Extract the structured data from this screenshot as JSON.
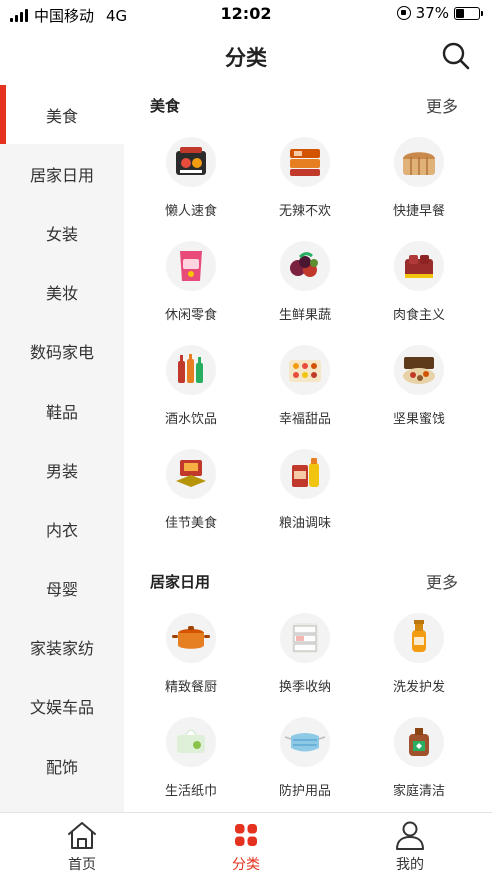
{
  "status": {
    "carrier": "中国移动",
    "network": "4G",
    "time": "12:02",
    "battery": "37%",
    "battery_level": 0.37
  },
  "header": {
    "title": "分类"
  },
  "sidebar": {
    "items": [
      {
        "label": "美食",
        "active": true
      },
      {
        "label": "居家日用"
      },
      {
        "label": "女装"
      },
      {
        "label": "美妆"
      },
      {
        "label": "数码家电"
      },
      {
        "label": "鞋品"
      },
      {
        "label": "男装"
      },
      {
        "label": "内衣"
      },
      {
        "label": "母婴"
      },
      {
        "label": "家装家纺"
      },
      {
        "label": "文娱车品"
      },
      {
        "label": "配饰"
      }
    ]
  },
  "sections": [
    {
      "title": "美食",
      "more": "更多",
      "items": [
        {
          "label": "懒人速食",
          "icon": "instant-noodles-icon"
        },
        {
          "label": "无辣不欢",
          "icon": "spicy-snack-icon"
        },
        {
          "label": "快捷早餐",
          "icon": "bread-icon"
        },
        {
          "label": "休闲零食",
          "icon": "snack-bag-icon"
        },
        {
          "label": "生鲜果蔬",
          "icon": "fruit-icon"
        },
        {
          "label": "肉食主义",
          "icon": "meat-icon"
        },
        {
          "label": "酒水饮品",
          "icon": "drinks-icon"
        },
        {
          "label": "幸福甜品",
          "icon": "dessert-box-icon"
        },
        {
          "label": "坚果蜜饯",
          "icon": "nuts-gift-box-icon"
        },
        {
          "label": "佳节美食",
          "icon": "festival-food-icon"
        },
        {
          "label": "粮油调味",
          "icon": "rice-oil-icon"
        }
      ]
    },
    {
      "title": "居家日用",
      "more": "更多",
      "items": [
        {
          "label": "精致餐厨",
          "icon": "cooking-pot-icon"
        },
        {
          "label": "换季收纳",
          "icon": "storage-drawer-icon"
        },
        {
          "label": "洗发护发",
          "icon": "shampoo-bottle-icon"
        },
        {
          "label": "生活纸巾",
          "icon": "tissue-icon"
        },
        {
          "label": "防护用品",
          "icon": "face-mask-icon"
        },
        {
          "label": "家庭清洁",
          "icon": "disinfectant-bottle-icon"
        }
      ]
    }
  ],
  "tabbar": {
    "tabs": [
      {
        "label": "首页",
        "icon": "home-icon"
      },
      {
        "label": "分类",
        "icon": "category-grid-icon",
        "active": true
      },
      {
        "label": "我的",
        "icon": "user-icon"
      }
    ]
  },
  "colors": {
    "accent": "#e5321f",
    "sidebar_bg": "#f5f5f5"
  }
}
